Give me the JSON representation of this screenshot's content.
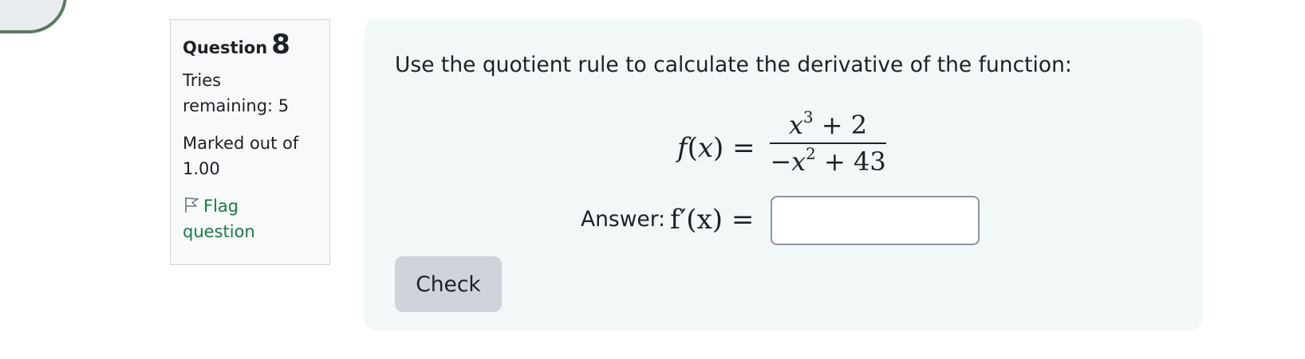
{
  "question": {
    "label": "Question",
    "number": "8"
  },
  "info": {
    "tries_line1": "Tries",
    "tries_line2": "remaining: 5",
    "marked_line1": "Marked out of",
    "marked_line2": "1.00",
    "flag_line1": "Flag",
    "flag_line2": "question"
  },
  "content": {
    "prompt": "Use the quotient rule to calculate the derivative of the function:",
    "formula": {
      "lhs_fn": "f",
      "lhs_var": "x",
      "numerator_base": "x",
      "numerator_exp": "3",
      "numerator_rest": " + 2",
      "denominator_sign": "−",
      "denominator_base": "x",
      "denominator_exp": "2",
      "denominator_rest": " + 43"
    },
    "answer_label": "Answer:",
    "answer_math": "f′(x) =",
    "answer_value": "",
    "answer_placeholder": "",
    "check_label": "Check"
  },
  "colors": {
    "flag_link": "#15803d",
    "panel_bg": "#f2f7f7",
    "info_bg": "#f8f9fa",
    "button_bg": "#ced4da",
    "corner_border": "#5a7d62"
  },
  "icons": {
    "flag": "flag-outline-icon"
  }
}
